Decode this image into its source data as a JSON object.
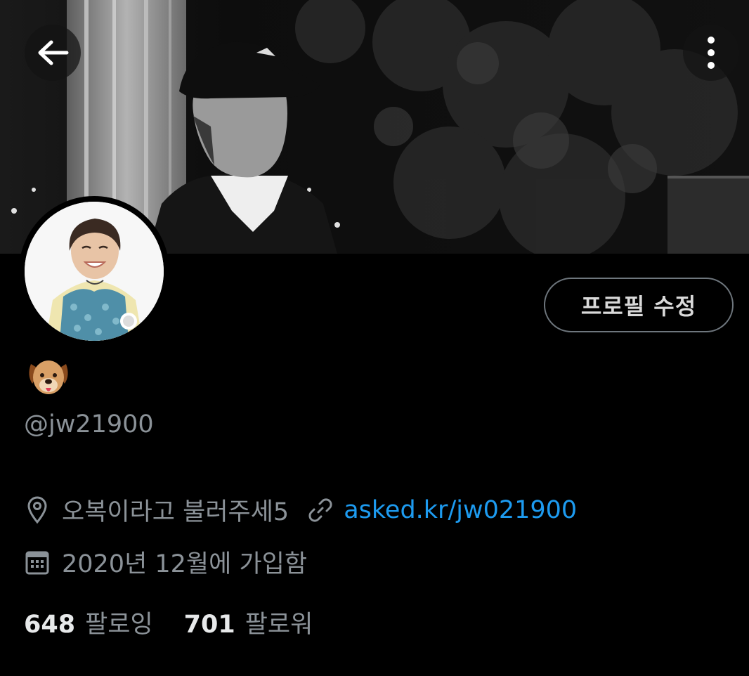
{
  "header": {
    "back_icon": "arrow-left-icon",
    "more_icon": "more-vertical-icon"
  },
  "profile": {
    "name_emoji": "🐶",
    "handle": "@jw21900",
    "edit_label": "프로필 수정",
    "location": "오복이라고 불러주세5",
    "link": "asked.kr/jw021900",
    "joined": "2020년 12월에 가입함",
    "following_count": "648",
    "following_label": "팔로잉",
    "followers_count": "701",
    "followers_label": "팔로워"
  },
  "icons": {
    "location": "location-pin-icon",
    "link": "link-icon",
    "calendar": "calendar-icon"
  },
  "colors": {
    "background": "#000000",
    "accent_link": "#1d9bf0",
    "secondary_text": "#8b9298",
    "border": "#6e767d"
  }
}
